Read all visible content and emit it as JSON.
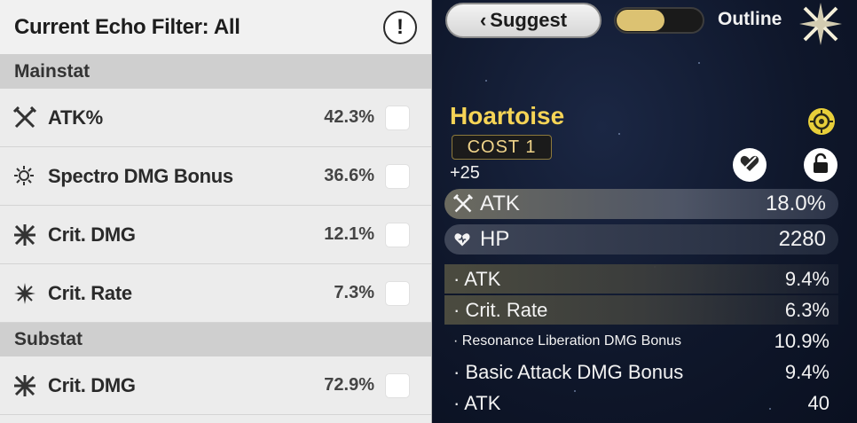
{
  "filter": {
    "title": "Current Echo Filter: All",
    "info_glyph": "!",
    "mainstat_heading": "Mainstat",
    "substat_heading": "Substat",
    "mainstats": [
      {
        "name": "ATK%",
        "pct": "42.3%",
        "icon": "atk-icon"
      },
      {
        "name": "Spectro DMG Bonus",
        "pct": "36.6%",
        "icon": "spectro-icon"
      },
      {
        "name": "Crit. DMG",
        "pct": "12.1%",
        "icon": "crit-dmg-icon"
      },
      {
        "name": "Crit. Rate",
        "pct": "7.3%",
        "icon": "crit-rate-icon"
      }
    ],
    "substats": [
      {
        "name": "Crit. DMG",
        "pct": "72.9%",
        "icon": "crit-dmg-icon"
      }
    ]
  },
  "top": {
    "suggest_label": "Suggest",
    "outline_label": "Outline",
    "toggle_on": true
  },
  "echo": {
    "name": "Hoartoise",
    "cost": "COST  1",
    "level": "+25",
    "main_atk": {
      "name": "ATK",
      "value": "18.0%"
    },
    "main_hp": {
      "name": "HP",
      "value": "2280"
    },
    "subs": [
      {
        "name": "· ATK",
        "value": "9.4%",
        "highlight": true
      },
      {
        "name": "· Crit. Rate",
        "value": "6.3%",
        "highlight": true
      },
      {
        "name": "· Resonance Liberation DMG Bonus",
        "value": "10.9%",
        "highlight": false
      },
      {
        "name": "· Basic Attack DMG Bonus",
        "value": "9.4%",
        "highlight": false
      },
      {
        "name": "· ATK",
        "value": "40",
        "highlight": false
      }
    ]
  },
  "colors": {
    "accent_gold": "#f6d456",
    "toggle_gold": "#dcc272"
  }
}
